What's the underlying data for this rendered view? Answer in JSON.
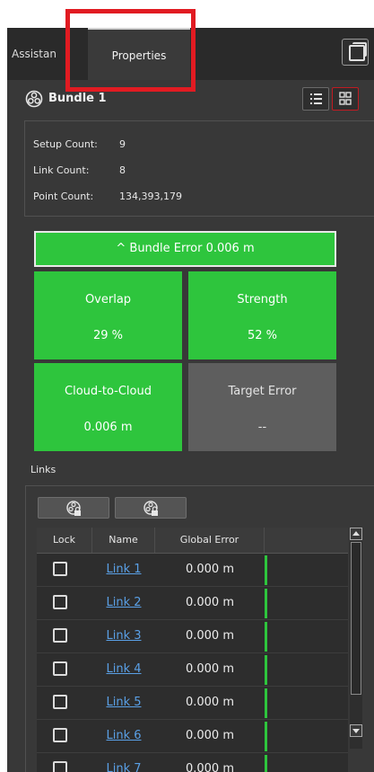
{
  "tabs": {
    "assistant_label": "Assistan",
    "properties_label": "Properties"
  },
  "bundle": {
    "title": "Bundle 1",
    "icon": "bundle-icon"
  },
  "summary": [
    {
      "label": "Setup Count:",
      "value": "9"
    },
    {
      "label": "Link Count:",
      "value": "8"
    },
    {
      "label": "Point Count:",
      "value": "134,393,179"
    }
  ],
  "metrics": {
    "bundle_error_label": "^ Bundle Error 0.006 m",
    "overlap": {
      "label": "Overlap",
      "value": "29 %"
    },
    "strength": {
      "label": "Strength",
      "value": "52 %"
    },
    "cloud_to_cloud": {
      "label": "Cloud-to-Cloud",
      "value": "0.006 m"
    },
    "target_error": {
      "label": "Target Error",
      "value": "--"
    }
  },
  "links": {
    "heading": "Links",
    "columns": [
      "Lock",
      "Name",
      "Global Error"
    ],
    "rows": [
      {
        "name": "Link 1",
        "error": "0.000 m"
      },
      {
        "name": "Link 2",
        "error": "0.000 m"
      },
      {
        "name": "Link 3",
        "error": "0.000 m"
      },
      {
        "name": "Link 4",
        "error": "0.000 m"
      },
      {
        "name": "Link 5",
        "error": "0.000 m"
      },
      {
        "name": "Link 6",
        "error": "0.000 m"
      },
      {
        "name": "Link 7",
        "error": "0.000 m"
      }
    ]
  },
  "colors": {
    "ok_green": "#2ec53d",
    "neutral_tile": "#5e5e5e",
    "highlight_red": "#e11b22",
    "link_blue": "#5aa0e6"
  }
}
